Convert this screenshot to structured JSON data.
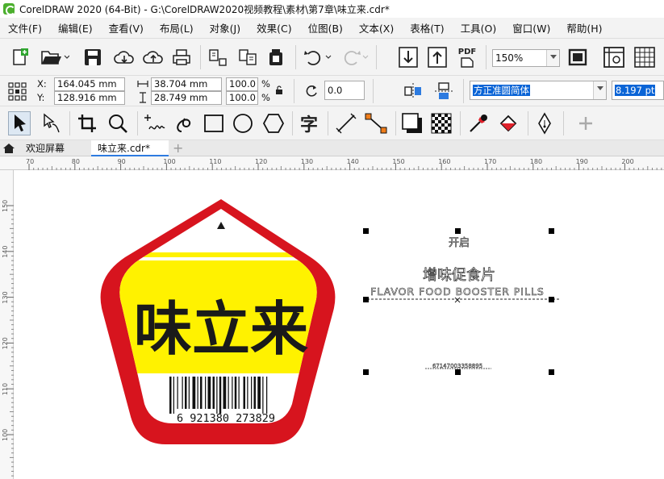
{
  "window": {
    "title": "CorelDRAW 2020 (64-Bit) - G:\\CorelDRAW2020视频教程\\素材\\第7章\\味立来.cdr*"
  },
  "menu": [
    "文件(F)",
    "编辑(E)",
    "查看(V)",
    "布局(L)",
    "对象(J)",
    "效果(C)",
    "位图(B)",
    "文本(X)",
    "表格(T)",
    "工具(O)",
    "窗口(W)",
    "帮助(H)"
  ],
  "toolbar": {
    "zoom_value": "150%",
    "pdf_label": "PDF"
  },
  "property_bar": {
    "x_label": "X:",
    "y_label": "Y:",
    "x_value": "164.045 mm",
    "y_value": "128.916 mm",
    "width_value": "38.704 mm",
    "height_value": "28.749 mm",
    "scale_x": "100.0",
    "scale_y": "100.0",
    "percent": "%",
    "rotation": "0.0",
    "font_name": "方正准圆简体",
    "font_size": "8.197 pt"
  },
  "tools": {
    "text_tool_glyph": "字"
  },
  "tabs": {
    "welcome": "欢迎屏幕",
    "document": "味立来.cdr*",
    "add": "+"
  },
  "ruler": {
    "h_ticks": [
      "70",
      "80",
      "90",
      "100",
      "110",
      "120",
      "130",
      "140",
      "150",
      "160",
      "170",
      "180",
      "190",
      "200"
    ],
    "v_ticks": [
      "150",
      "140",
      "130",
      "120",
      "110",
      "100"
    ]
  },
  "artwork": {
    "brand_text": "味立来",
    "barcode_number": "6  921380  273829",
    "colors": {
      "red": "#d7141e",
      "yellow": "#fff200",
      "black": "#1a1a1a"
    }
  },
  "selected_text": {
    "line1": "开启",
    "line2": "增味促食片",
    "line3": "FLAVOR FOOD BOOSTER PILLS",
    "line4": "67147003358895"
  }
}
